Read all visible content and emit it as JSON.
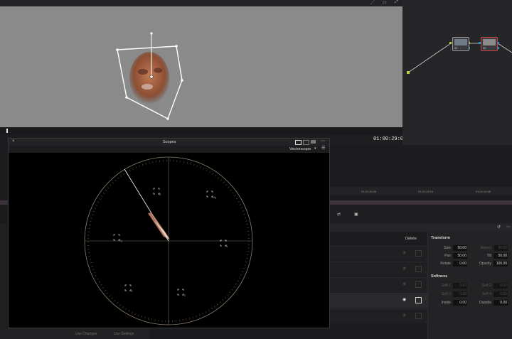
{
  "viewer": {
    "timecode": "01:00:29:05",
    "top_icons": [
      "share-icon",
      "layout-icon",
      "expand-icon"
    ]
  },
  "node_editor": {
    "nodes": [
      {
        "label": "01"
      },
      {
        "label": "02"
      }
    ]
  },
  "timeline": {
    "ticks": [
      "01:01:25:35",
      "01:01:33:15",
      "01:01:40:35"
    ]
  },
  "scopes": {
    "title": "Scopes",
    "mode": "Vectorscope",
    "targets": [
      "R",
      "Mg",
      "B",
      "Cy",
      "G",
      "Yl"
    ]
  },
  "keyer": {
    "delete_label": "Delete"
  },
  "transform": {
    "section_title": "Transform",
    "fields": {
      "size_label": "Size",
      "size": "50.00",
      "aspect_label": "Aspect",
      "aspect": "50.00",
      "pan_label": "Pan",
      "pan": "50.00",
      "tilt_label": "Tilt",
      "tilt": "50.00",
      "rotate_label": "Rotate",
      "rotate": "0.00",
      "opacity_label": "Opacity",
      "opacity": "100.00"
    }
  },
  "softness": {
    "section_title": "Softness",
    "fields": {
      "soft1_label": "Soft 1",
      "soft1": "0.00",
      "soft2_label": "Soft 2",
      "soft2": "0.00",
      "soft3_label": "Soft 3",
      "soft3": "0.00",
      "soft4_label": "Soft 4",
      "soft4": "0.00",
      "inside_label": "Inside",
      "inside": "0.00",
      "outside_label": "Outside",
      "outside": "0.00"
    }
  },
  "bottom": {
    "use_changes": "Use Changes",
    "use_settings": "Use Settings"
  },
  "colors": {
    "accent": "#e04848",
    "scope_ring": "#8a7d6a"
  }
}
